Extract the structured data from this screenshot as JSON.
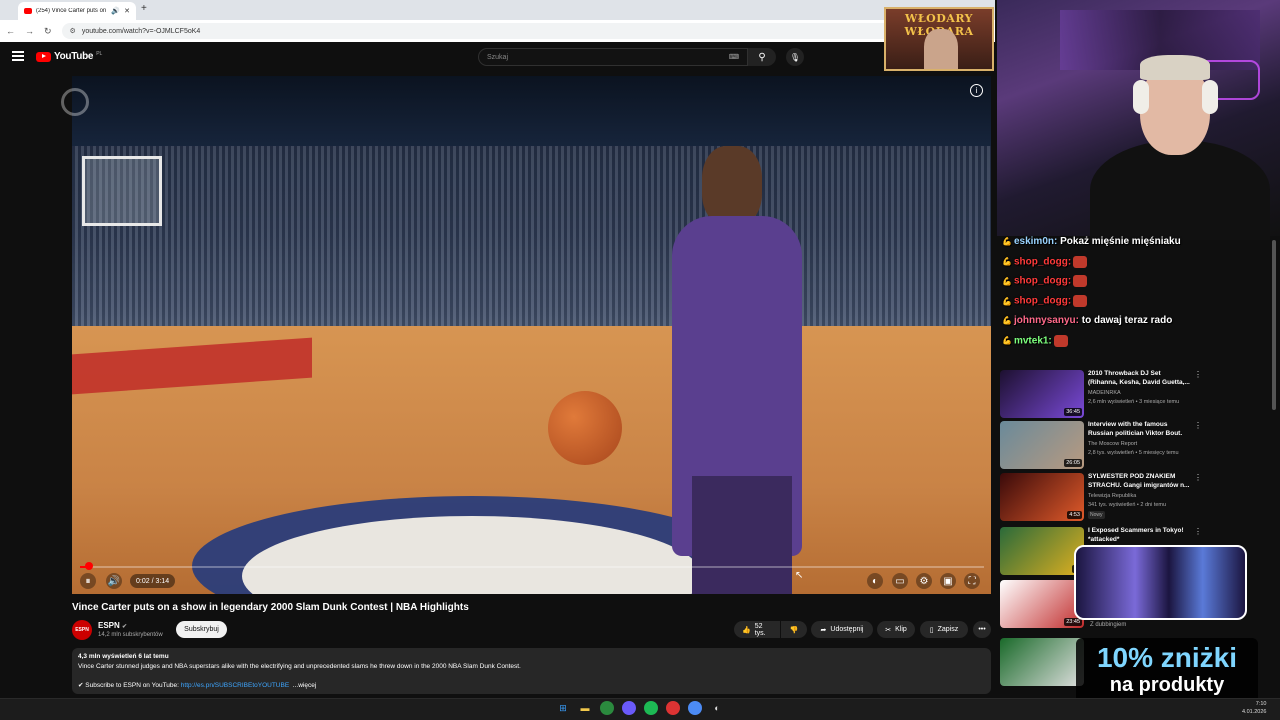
{
  "browser": {
    "tab_title": "(254) Vince Carter puts on a",
    "tab_audio_icon": "speaker-icon",
    "new_tab": "+",
    "url": "youtube.com/watch?v=-OJMLCF5oK4"
  },
  "youtube": {
    "logo_text": "YouTube",
    "country": "PL",
    "search_placeholder": "Szukaj"
  },
  "player": {
    "time": "0:02 / 3:14",
    "progress": 0.0103
  },
  "video": {
    "title": "Vince Carter puts on a show in legendary 2000 Slam Dunk Contest | NBA Highlights",
    "channel": "ESPN",
    "channel_avatar": "ESPN",
    "subscribers": "14,2 mln subskrybentów",
    "subscribe_label": "Subskrybuj",
    "likes": "52 tys.",
    "share_label": "Udostępnij",
    "clip_label": "Klip",
    "save_label": "Zapisz",
    "more_label": "•••",
    "desc_stats": "4,3 mln wyświetleń  6 lat temu",
    "desc_text": "Vince Carter stunned judges and NBA superstars alike with the electrifying and unprecedented slams he threw down in the 2000 NBA Slam Dunk Contest.",
    "desc_sub_prefix": "✔ Subscribe to ESPN on YouTube: ",
    "desc_link": "http://es.pn/SUBSCRIBEtoYOUTUBE",
    "desc_more": "...więcej"
  },
  "overlay": {
    "emblem_text": "WŁODARY WŁODARA",
    "chat": [
      {
        "user": "eskim0n:",
        "text": " Pokaż mięśnie mięśniaku",
        "color": "u-blue"
      },
      {
        "user": "shop_dogg:",
        "text": "",
        "color": "u-red"
      },
      {
        "user": "shop_dogg:",
        "text": "",
        "color": "u-red"
      },
      {
        "user": "shop_dogg:",
        "text": "",
        "color": "u-red"
      },
      {
        "user": "johnnysanyu:",
        "text": " to dawaj teraz rado",
        "color": "u-pink"
      },
      {
        "user": "mvtek1:",
        "text": "",
        "color": "u-green"
      }
    ],
    "dubbing": "Z dubbingiem",
    "promo_line1": "10% zniżki",
    "promo_line2": "na produkty"
  },
  "recommendations": [
    {
      "title": "2010 Throwback DJ Set (Rihanna, Kesha, David Guetta,...",
      "channel": "MADEINRKA",
      "views": "2,6 mln wyświetleń • 3 miesiące temu",
      "duration": "36:45",
      "colors": [
        "#1d1030",
        "#7a4ad8"
      ]
    },
    {
      "title": "Interview with the famous Russian politician Viktor Bout.",
      "channel": "The Moscow Report",
      "views": "2,8 tys. wyświetleń • 5 miesięcy temu",
      "duration": "26:05",
      "colors": [
        "#6a8a9a",
        "#b89a80"
      ]
    },
    {
      "title": "SYLWESTER POD ZNAKIEM STRACHU. Gangi imigrantów n...",
      "channel": "Telewizja Republika",
      "views": "341 tys. wyświetleń • 2 dni temu",
      "duration": "4:53",
      "badge": "Nowy",
      "colors": [
        "#3a0a0a",
        "#e05a2a"
      ]
    },
    {
      "title": "I Exposed Scammers in Tokyo! *attacked*",
      "channel": "",
      "views": "",
      "duration": "45",
      "colors": [
        "#2a6a3a",
        "#e0b020"
      ]
    },
    {
      "title": "",
      "channel": "",
      "views": "",
      "duration": "23:45",
      "colors": [
        "#ffffff",
        "#c02a2a"
      ]
    },
    {
      "title": "",
      "channel": "",
      "views": "",
      "duration": "",
      "colors": [
        "#1a6a2a",
        "#e0e0e0"
      ]
    }
  ],
  "taskbar": {
    "time": "7:10",
    "date": "4.01.2026"
  },
  "icons": {
    "pause": "⏸",
    "volume": "🔊",
    "settings": "⚙",
    "fullscreen": "⛶",
    "subtitles": "▭",
    "miniplayer": "▣",
    "like": "👍",
    "dislike": "👎",
    "share": "➦",
    "clip": "✂",
    "save": "🔖",
    "search": "⚲",
    "mic": "🎙"
  }
}
